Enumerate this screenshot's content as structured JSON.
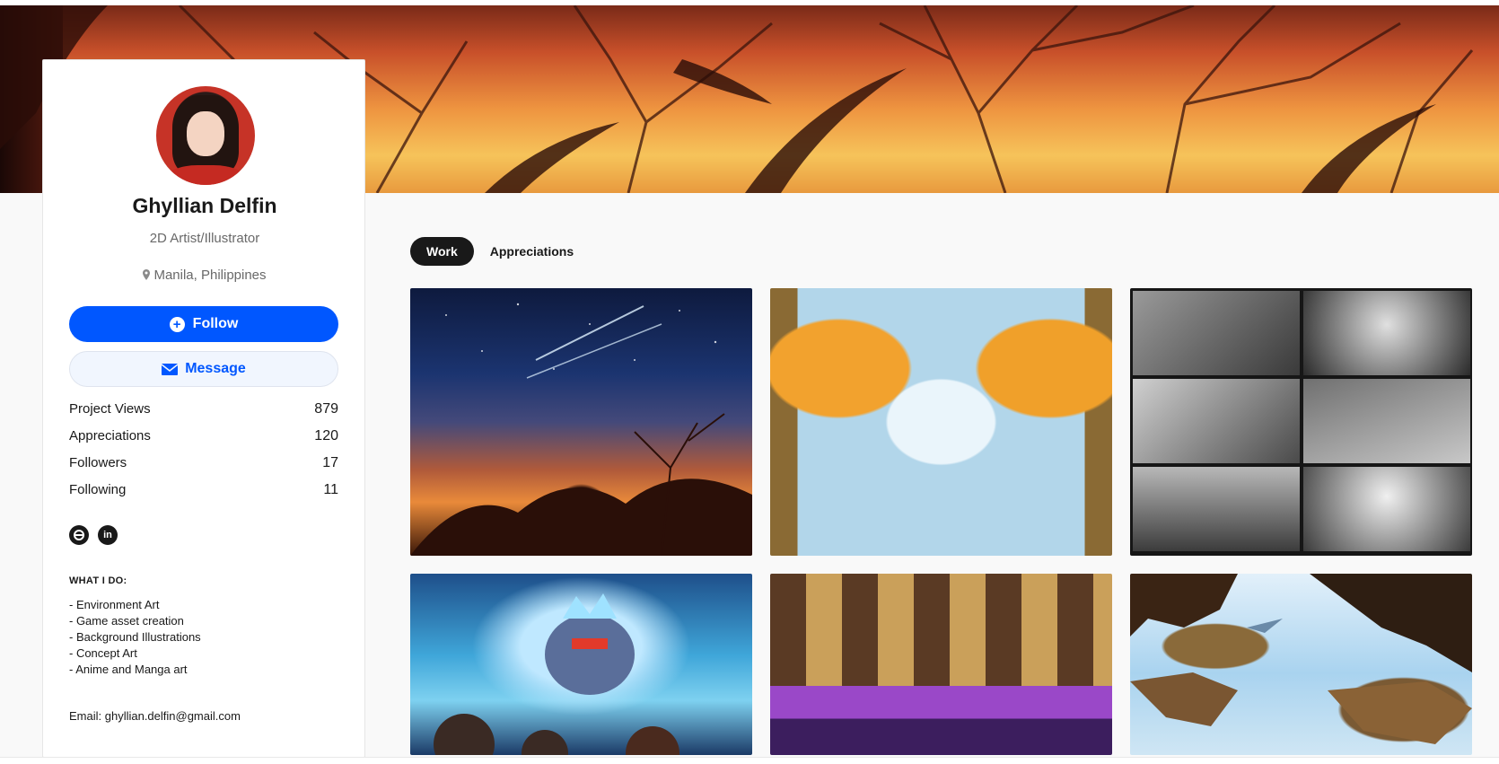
{
  "profile": {
    "name": "Ghyllian Delfin",
    "occupation": "2D Artist/Illustrator",
    "location": "Manila, Philippines",
    "follow_label": "Follow",
    "message_label": "Message",
    "stats": [
      {
        "label": "Project Views",
        "value": "879"
      },
      {
        "label": "Appreciations",
        "value": "120"
      },
      {
        "label": "Followers",
        "value": "17"
      },
      {
        "label": "Following",
        "value": "11"
      }
    ],
    "socials": [
      {
        "icon": "behance-icon"
      },
      {
        "icon": "linkedin-icon"
      }
    ],
    "what_i_do_title": "WHAT I DO:",
    "what_i_do": [
      "- Environment Art",
      "- Game asset creation",
      "- Background Illustrations",
      "- Concept Art",
      "- Anime and Manga art"
    ],
    "email": "Email: ghyllian.delfin@gmail.com"
  },
  "tabs": [
    {
      "label": "Work",
      "active": true
    },
    {
      "label": "Appreciations",
      "active": false
    }
  ],
  "colors": {
    "accent": "#0057ff",
    "tab_active_bg": "#191919",
    "page_bg": "#f9f9f9"
  }
}
